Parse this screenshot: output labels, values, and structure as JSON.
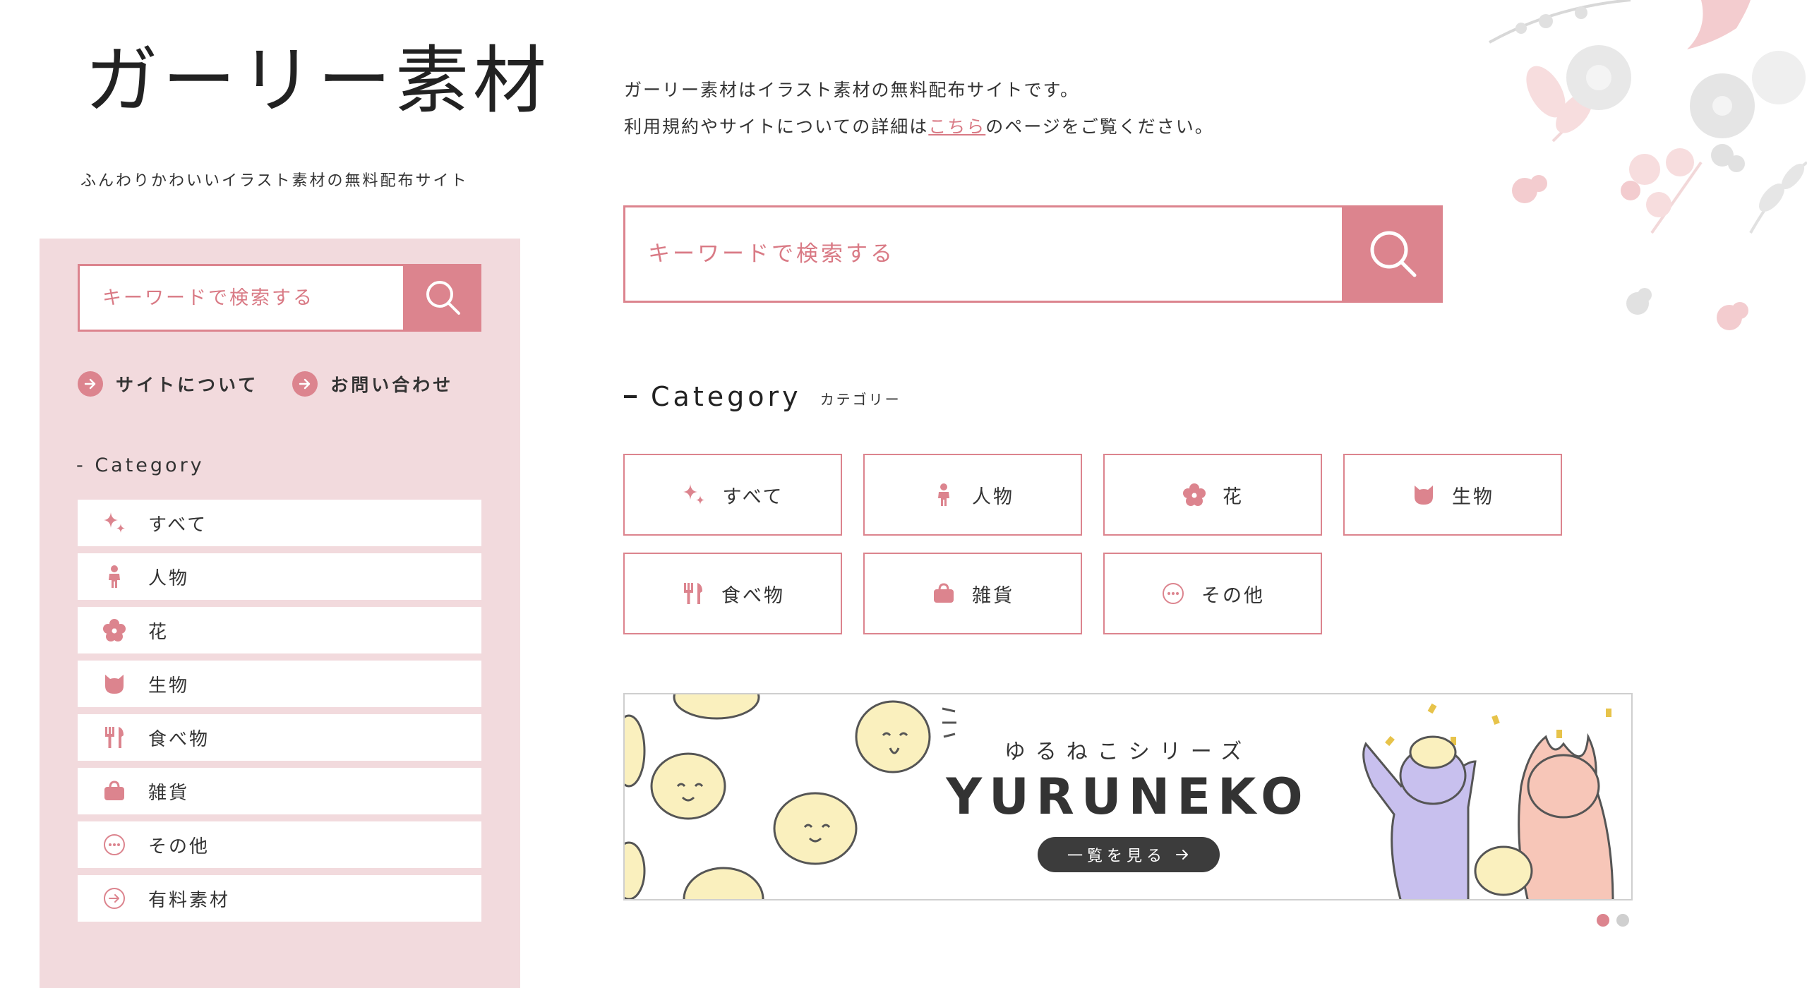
{
  "site": {
    "logo": "ガーリー素材",
    "tagline": "ふんわりかわいいイラスト素材の無料配布サイト"
  },
  "colors": {
    "accent": "#dc848e",
    "sidebar_bg": "#f2dadd",
    "text": "#333333",
    "pill_bg": "#3c3c3c"
  },
  "sidebar": {
    "search": {
      "placeholder": "キーワードで検索する",
      "value": "",
      "button_icon": "search-icon"
    },
    "links": [
      {
        "label": "サイトについて",
        "icon": "arrow-right-circle-icon"
      },
      {
        "label": "お問い合わせ",
        "icon": "arrow-right-circle-icon"
      }
    ],
    "category_title": "- Category",
    "categories": [
      {
        "label": "すべて",
        "icon": "sparkle-icon"
      },
      {
        "label": "人物",
        "icon": "person-icon"
      },
      {
        "label": "花",
        "icon": "flower-icon"
      },
      {
        "label": "生物",
        "icon": "cat-icon"
      },
      {
        "label": "食べ物",
        "icon": "cutlery-icon"
      },
      {
        "label": "雑貨",
        "icon": "bag-icon"
      },
      {
        "label": "その他",
        "icon": "more-icon"
      },
      {
        "label": "有料素材",
        "icon": "arrow-right-circle-outline-icon"
      }
    ]
  },
  "main": {
    "intro_line1": "ガーリー素材はイラスト素材の無料配布サイトです。",
    "intro_line2_before": "利用規約やサイトについての詳細は",
    "intro_link": "こちら",
    "intro_line2_after": "のページをご覧ください。",
    "search": {
      "placeholder": "キーワードで検索する",
      "value": "",
      "button_icon": "search-icon"
    },
    "category_heading": "Category",
    "category_heading_ja": "カテゴリー",
    "categories": [
      {
        "label": "すべて",
        "icon": "sparkle-icon"
      },
      {
        "label": "人物",
        "icon": "person-icon"
      },
      {
        "label": "花",
        "icon": "flower-icon"
      },
      {
        "label": "生物",
        "icon": "cat-icon"
      },
      {
        "label": "食べ物",
        "icon": "cutlery-icon"
      },
      {
        "label": "雑貨",
        "icon": "bag-icon"
      },
      {
        "label": "その他",
        "icon": "more-icon"
      }
    ]
  },
  "banner": {
    "subtitle": "ゆるねこシリーズ",
    "title": "YURUNEKO",
    "button_label": "一覧を見る",
    "slides_total": 2,
    "active_slide": 1
  }
}
